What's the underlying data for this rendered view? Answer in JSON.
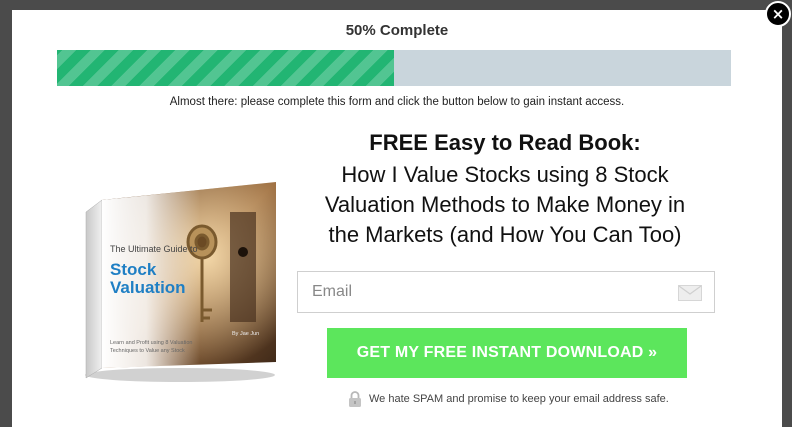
{
  "close_label": "×",
  "progress": {
    "label": "50% Complete",
    "value_percent": 50
  },
  "instruction": "Almost there: please complete this form and click the button below to gain instant access.",
  "headline": {
    "bold": "FREE Easy to Read Book:",
    "lines": [
      "How I Value Stocks using 8 Stock",
      "Valuation Methods to Make Money in",
      "the Markets (and How You Can Too)"
    ]
  },
  "email": {
    "placeholder": "Email",
    "icon": "envelope-icon"
  },
  "cta_label": "GET MY FREE INSTANT DOWNLOAD »",
  "spam_note": "We hate SPAM and promise to keep your email address safe.",
  "book_cover": {
    "small_title": "The Ultimate Guide to",
    "title_line1": "Stock",
    "title_line2": "Valuation",
    "tagline_line1": "Learn and Profit using 8 Valuation",
    "tagline_line2": "Techniques to Value any Stock",
    "author": "By Jae Jun"
  },
  "colors": {
    "overlay": "#4b4b4b",
    "progress_fill": "#22b573",
    "progress_track": "#c9d5dc",
    "cta": "#5ce65c",
    "book_title": "#1f7fc4"
  }
}
